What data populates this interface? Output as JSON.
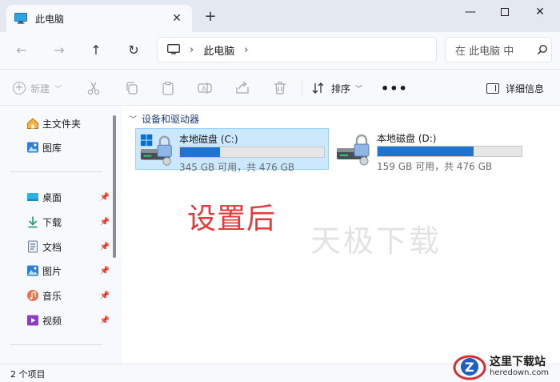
{
  "tab": {
    "title": "此电脑",
    "close": "✕",
    "new": "+"
  },
  "window": {
    "minimize": "—",
    "close": "✕"
  },
  "nav": {
    "back": "←",
    "forward": "→",
    "up": "↑",
    "refresh": "↻"
  },
  "address": {
    "separator": "›",
    "crumbs": [
      "此电脑"
    ],
    "end_separator": "›"
  },
  "search": {
    "placeholder": "在 此电脑 中",
    "icon": "search-icon"
  },
  "toolbar": {
    "new_label": "新建",
    "sort_label": "排序",
    "more": "•••",
    "details_label": "详细信息"
  },
  "sidebar": {
    "top_items": [
      {
        "label": "主文件夹",
        "icon": "home-icon"
      },
      {
        "label": "图库",
        "icon": "gallery-icon"
      }
    ],
    "pinned_items": [
      {
        "label": "桌面",
        "icon": "desktop-icon"
      },
      {
        "label": "下载",
        "icon": "download-icon"
      },
      {
        "label": "文档",
        "icon": "document-icon"
      },
      {
        "label": "图片",
        "icon": "pictures-icon"
      },
      {
        "label": "音乐",
        "icon": "music-icon"
      },
      {
        "label": "视频",
        "icon": "video-icon"
      }
    ]
  },
  "content": {
    "group_title": "设备和驱动器",
    "drives": [
      {
        "name": "本地磁盘 (C:)",
        "space": "345 GB 可用，共 476 GB",
        "used_fraction": 0.275,
        "selected": true
      },
      {
        "name": "本地磁盘 (D:)",
        "space": "159 GB 可用，共 476 GB",
        "used_fraction": 0.666,
        "selected": false
      }
    ],
    "annotation": "设置后",
    "watermark": "天极下载"
  },
  "status": {
    "text": "2 个项目"
  },
  "logo": {
    "cn": "这里下载站",
    "en": "heredown.com"
  },
  "colors": {
    "accent": "#1f74d1",
    "selection": "#cce8ff",
    "annotation": "#e5393b"
  }
}
